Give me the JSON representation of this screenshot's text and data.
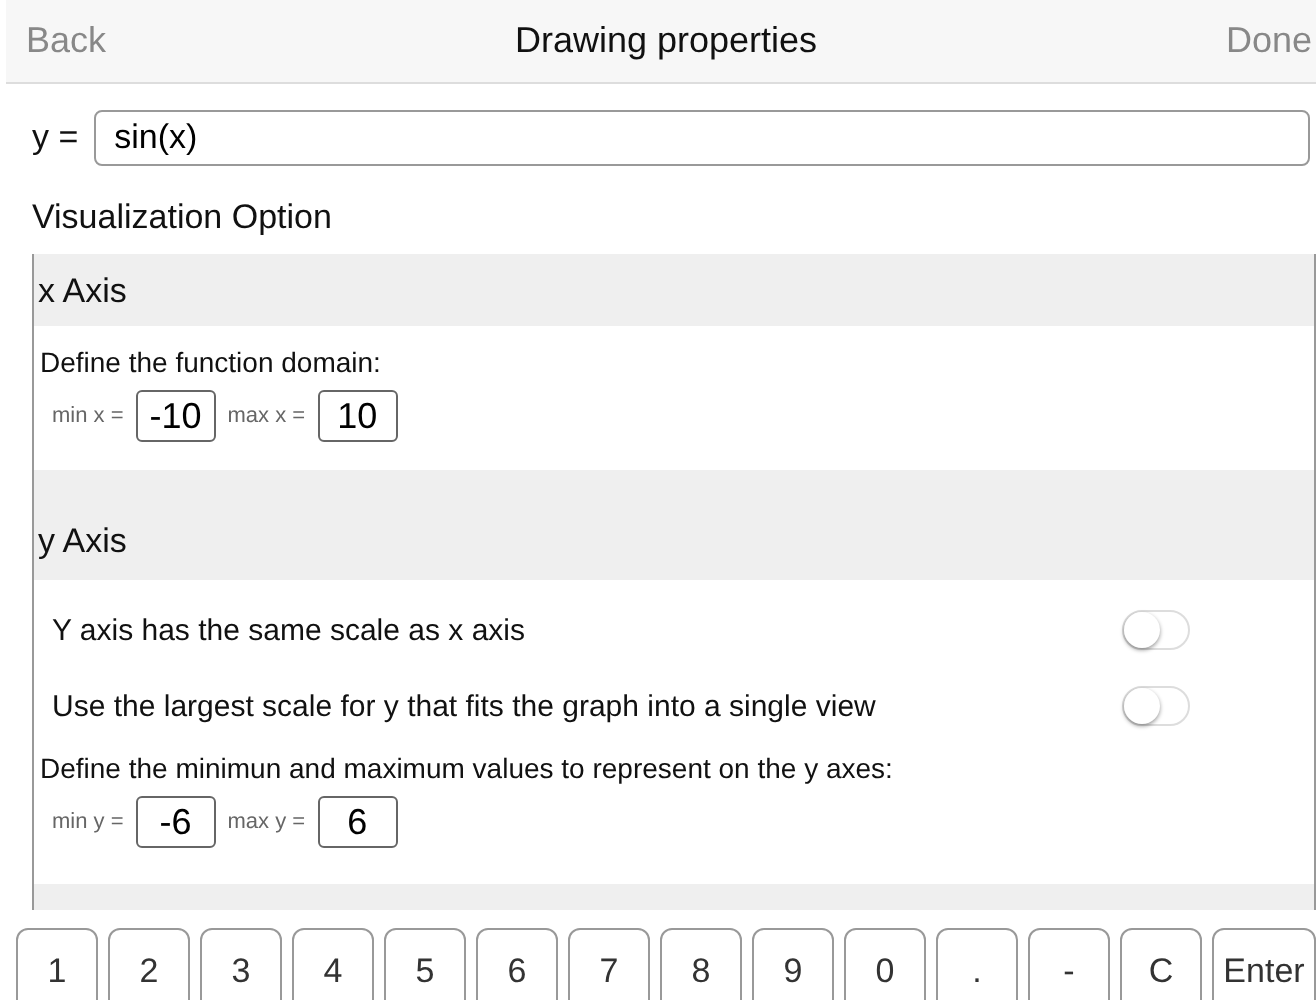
{
  "nav": {
    "back": "Back",
    "title": "Drawing properties",
    "done": "Done"
  },
  "function": {
    "label": "y =",
    "value": "sin(x)"
  },
  "section_title": "Visualization Option",
  "x_axis": {
    "title": "x Axis",
    "prompt": "Define the function domain:",
    "min_label": "min x =",
    "min": "-10",
    "max_label": "max x =",
    "max": "10"
  },
  "y_axis": {
    "title": "y Axis",
    "toggles": [
      {
        "label": "Y axis has the same scale as x axis",
        "on": false
      },
      {
        "label": "Use the largest scale for y that fits the graph into a single view",
        "on": false
      }
    ],
    "prompt": "Define the minimun and maximum values to represent on the y axes:",
    "min_label": "min y =",
    "min": "-6",
    "max_label": "max y =",
    "max": "6"
  },
  "keypad": [
    "1",
    "2",
    "3",
    "4",
    "5",
    "6",
    "7",
    "8",
    "9",
    "0",
    ".",
    "-",
    "C",
    "Enter"
  ]
}
